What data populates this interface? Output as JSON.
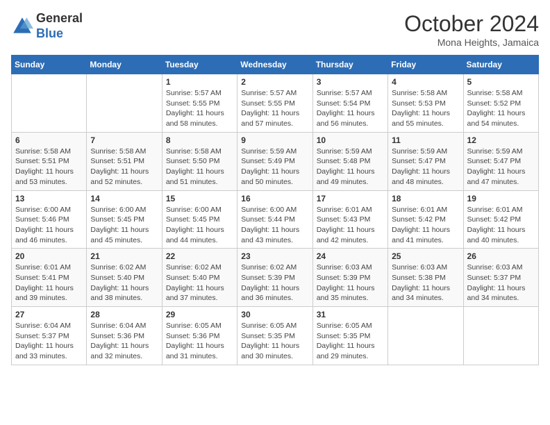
{
  "logo": {
    "general": "General",
    "blue": "Blue"
  },
  "header": {
    "month": "October 2024",
    "location": "Mona Heights, Jamaica"
  },
  "weekdays": [
    "Sunday",
    "Monday",
    "Tuesday",
    "Wednesday",
    "Thursday",
    "Friday",
    "Saturday"
  ],
  "weeks": [
    [
      {
        "day": "",
        "info": ""
      },
      {
        "day": "",
        "info": ""
      },
      {
        "day": "1",
        "info": "Sunrise: 5:57 AM\nSunset: 5:55 PM\nDaylight: 11 hours and 58 minutes."
      },
      {
        "day": "2",
        "info": "Sunrise: 5:57 AM\nSunset: 5:55 PM\nDaylight: 11 hours and 57 minutes."
      },
      {
        "day": "3",
        "info": "Sunrise: 5:57 AM\nSunset: 5:54 PM\nDaylight: 11 hours and 56 minutes."
      },
      {
        "day": "4",
        "info": "Sunrise: 5:58 AM\nSunset: 5:53 PM\nDaylight: 11 hours and 55 minutes."
      },
      {
        "day": "5",
        "info": "Sunrise: 5:58 AM\nSunset: 5:52 PM\nDaylight: 11 hours and 54 minutes."
      }
    ],
    [
      {
        "day": "6",
        "info": "Sunrise: 5:58 AM\nSunset: 5:51 PM\nDaylight: 11 hours and 53 minutes."
      },
      {
        "day": "7",
        "info": "Sunrise: 5:58 AM\nSunset: 5:51 PM\nDaylight: 11 hours and 52 minutes."
      },
      {
        "day": "8",
        "info": "Sunrise: 5:58 AM\nSunset: 5:50 PM\nDaylight: 11 hours and 51 minutes."
      },
      {
        "day": "9",
        "info": "Sunrise: 5:59 AM\nSunset: 5:49 PM\nDaylight: 11 hours and 50 minutes."
      },
      {
        "day": "10",
        "info": "Sunrise: 5:59 AM\nSunset: 5:48 PM\nDaylight: 11 hours and 49 minutes."
      },
      {
        "day": "11",
        "info": "Sunrise: 5:59 AM\nSunset: 5:47 PM\nDaylight: 11 hours and 48 minutes."
      },
      {
        "day": "12",
        "info": "Sunrise: 5:59 AM\nSunset: 5:47 PM\nDaylight: 11 hours and 47 minutes."
      }
    ],
    [
      {
        "day": "13",
        "info": "Sunrise: 6:00 AM\nSunset: 5:46 PM\nDaylight: 11 hours and 46 minutes."
      },
      {
        "day": "14",
        "info": "Sunrise: 6:00 AM\nSunset: 5:45 PM\nDaylight: 11 hours and 45 minutes."
      },
      {
        "day": "15",
        "info": "Sunrise: 6:00 AM\nSunset: 5:45 PM\nDaylight: 11 hours and 44 minutes."
      },
      {
        "day": "16",
        "info": "Sunrise: 6:00 AM\nSunset: 5:44 PM\nDaylight: 11 hours and 43 minutes."
      },
      {
        "day": "17",
        "info": "Sunrise: 6:01 AM\nSunset: 5:43 PM\nDaylight: 11 hours and 42 minutes."
      },
      {
        "day": "18",
        "info": "Sunrise: 6:01 AM\nSunset: 5:42 PM\nDaylight: 11 hours and 41 minutes."
      },
      {
        "day": "19",
        "info": "Sunrise: 6:01 AM\nSunset: 5:42 PM\nDaylight: 11 hours and 40 minutes."
      }
    ],
    [
      {
        "day": "20",
        "info": "Sunrise: 6:01 AM\nSunset: 5:41 PM\nDaylight: 11 hours and 39 minutes."
      },
      {
        "day": "21",
        "info": "Sunrise: 6:02 AM\nSunset: 5:40 PM\nDaylight: 11 hours and 38 minutes."
      },
      {
        "day": "22",
        "info": "Sunrise: 6:02 AM\nSunset: 5:40 PM\nDaylight: 11 hours and 37 minutes."
      },
      {
        "day": "23",
        "info": "Sunrise: 6:02 AM\nSunset: 5:39 PM\nDaylight: 11 hours and 36 minutes."
      },
      {
        "day": "24",
        "info": "Sunrise: 6:03 AM\nSunset: 5:39 PM\nDaylight: 11 hours and 35 minutes."
      },
      {
        "day": "25",
        "info": "Sunrise: 6:03 AM\nSunset: 5:38 PM\nDaylight: 11 hours and 34 minutes."
      },
      {
        "day": "26",
        "info": "Sunrise: 6:03 AM\nSunset: 5:37 PM\nDaylight: 11 hours and 34 minutes."
      }
    ],
    [
      {
        "day": "27",
        "info": "Sunrise: 6:04 AM\nSunset: 5:37 PM\nDaylight: 11 hours and 33 minutes."
      },
      {
        "day": "28",
        "info": "Sunrise: 6:04 AM\nSunset: 5:36 PM\nDaylight: 11 hours and 32 minutes."
      },
      {
        "day": "29",
        "info": "Sunrise: 6:05 AM\nSunset: 5:36 PM\nDaylight: 11 hours and 31 minutes."
      },
      {
        "day": "30",
        "info": "Sunrise: 6:05 AM\nSunset: 5:35 PM\nDaylight: 11 hours and 30 minutes."
      },
      {
        "day": "31",
        "info": "Sunrise: 6:05 AM\nSunset: 5:35 PM\nDaylight: 11 hours and 29 minutes."
      },
      {
        "day": "",
        "info": ""
      },
      {
        "day": "",
        "info": ""
      }
    ]
  ]
}
